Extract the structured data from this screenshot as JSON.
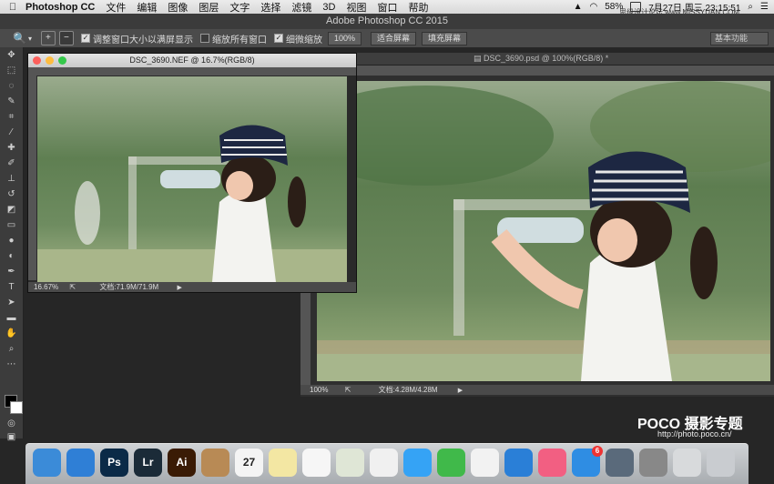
{
  "menubar": {
    "app_name": "Photoshop CC",
    "items": [
      "文件",
      "编辑",
      "图像",
      "图层",
      "文字",
      "选择",
      "滤镜",
      "3D",
      "视图",
      "窗口",
      "帮助"
    ],
    "battery": "58%",
    "datetime": "7月27日 周三 23:15:51",
    "watermark_top": "思缘设计论坛 www.MISSYUAN.COM"
  },
  "app_title": "Adobe Photoshop CC 2015",
  "options": {
    "check1": "调整窗口大小以满屏显示",
    "check2": "缩放所有窗口",
    "check3": "细微缩放",
    "btn_100": "100%",
    "btn_fit": "适合屏幕",
    "btn_fill": "填充屏幕",
    "workspace": "基本功能"
  },
  "doc1": {
    "title": "DSC_3690.NEF @ 16.7%(RGB/8)",
    "zoom": "16.67%",
    "docsize": "文档:71.9M/71.9M"
  },
  "doc2": {
    "title": "DSC_3690.psd @ 100%(RGB/8) *",
    "zoom": "100%",
    "docsize": "文档:4.28M/4.28M"
  },
  "watermark": {
    "brand": "POCO 摄影专题",
    "url": "http://photo.poco.cn/"
  },
  "dock": [
    {
      "label": "",
      "color": "#3b8bd8",
      "icon": "finder-icon"
    },
    {
      "label": "",
      "color": "#2f7fd6",
      "icon": "safari-icon"
    },
    {
      "label": "Ps",
      "color": "#0b2a47",
      "icon": "photoshop-icon"
    },
    {
      "label": "Lr",
      "color": "#1b2b38",
      "icon": "lightroom-icon"
    },
    {
      "label": "Ai",
      "color": "#3a1b05",
      "icon": "illustrator-icon"
    },
    {
      "label": "",
      "color": "#b88a55",
      "icon": "contacts-icon"
    },
    {
      "label": "27",
      "color": "#f4f4f4",
      "icon": "calendar-icon"
    },
    {
      "label": "",
      "color": "#f3e7a3",
      "icon": "notes-icon"
    },
    {
      "label": "",
      "color": "#f6f6f6",
      "icon": "reminders-icon"
    },
    {
      "label": "",
      "color": "#dfe6d6",
      "icon": "preview-icon"
    },
    {
      "label": "",
      "color": "#f0f0f0",
      "icon": "photos-icon"
    },
    {
      "label": "",
      "color": "#35a3f5",
      "icon": "messages-icon"
    },
    {
      "label": "",
      "color": "#40b94a",
      "icon": "facetime-icon"
    },
    {
      "label": "",
      "color": "#f2f2f2",
      "icon": "numbers-icon"
    },
    {
      "label": "",
      "color": "#2a7fd7",
      "icon": "keynote-icon"
    },
    {
      "label": "",
      "color": "#f25f82",
      "icon": "itunes-icon"
    },
    {
      "label": "6",
      "color": "#2f8de3",
      "icon": "appstore-icon"
    },
    {
      "label": "",
      "color": "#5a6a7b",
      "icon": "launchpad-icon"
    },
    {
      "label": "",
      "color": "#888",
      "icon": "system-preferences-icon"
    },
    {
      "label": "",
      "color": "#d8dadc",
      "icon": "downloads-icon"
    },
    {
      "label": "",
      "color": "#c9ccd0",
      "icon": "trash-icon"
    }
  ]
}
